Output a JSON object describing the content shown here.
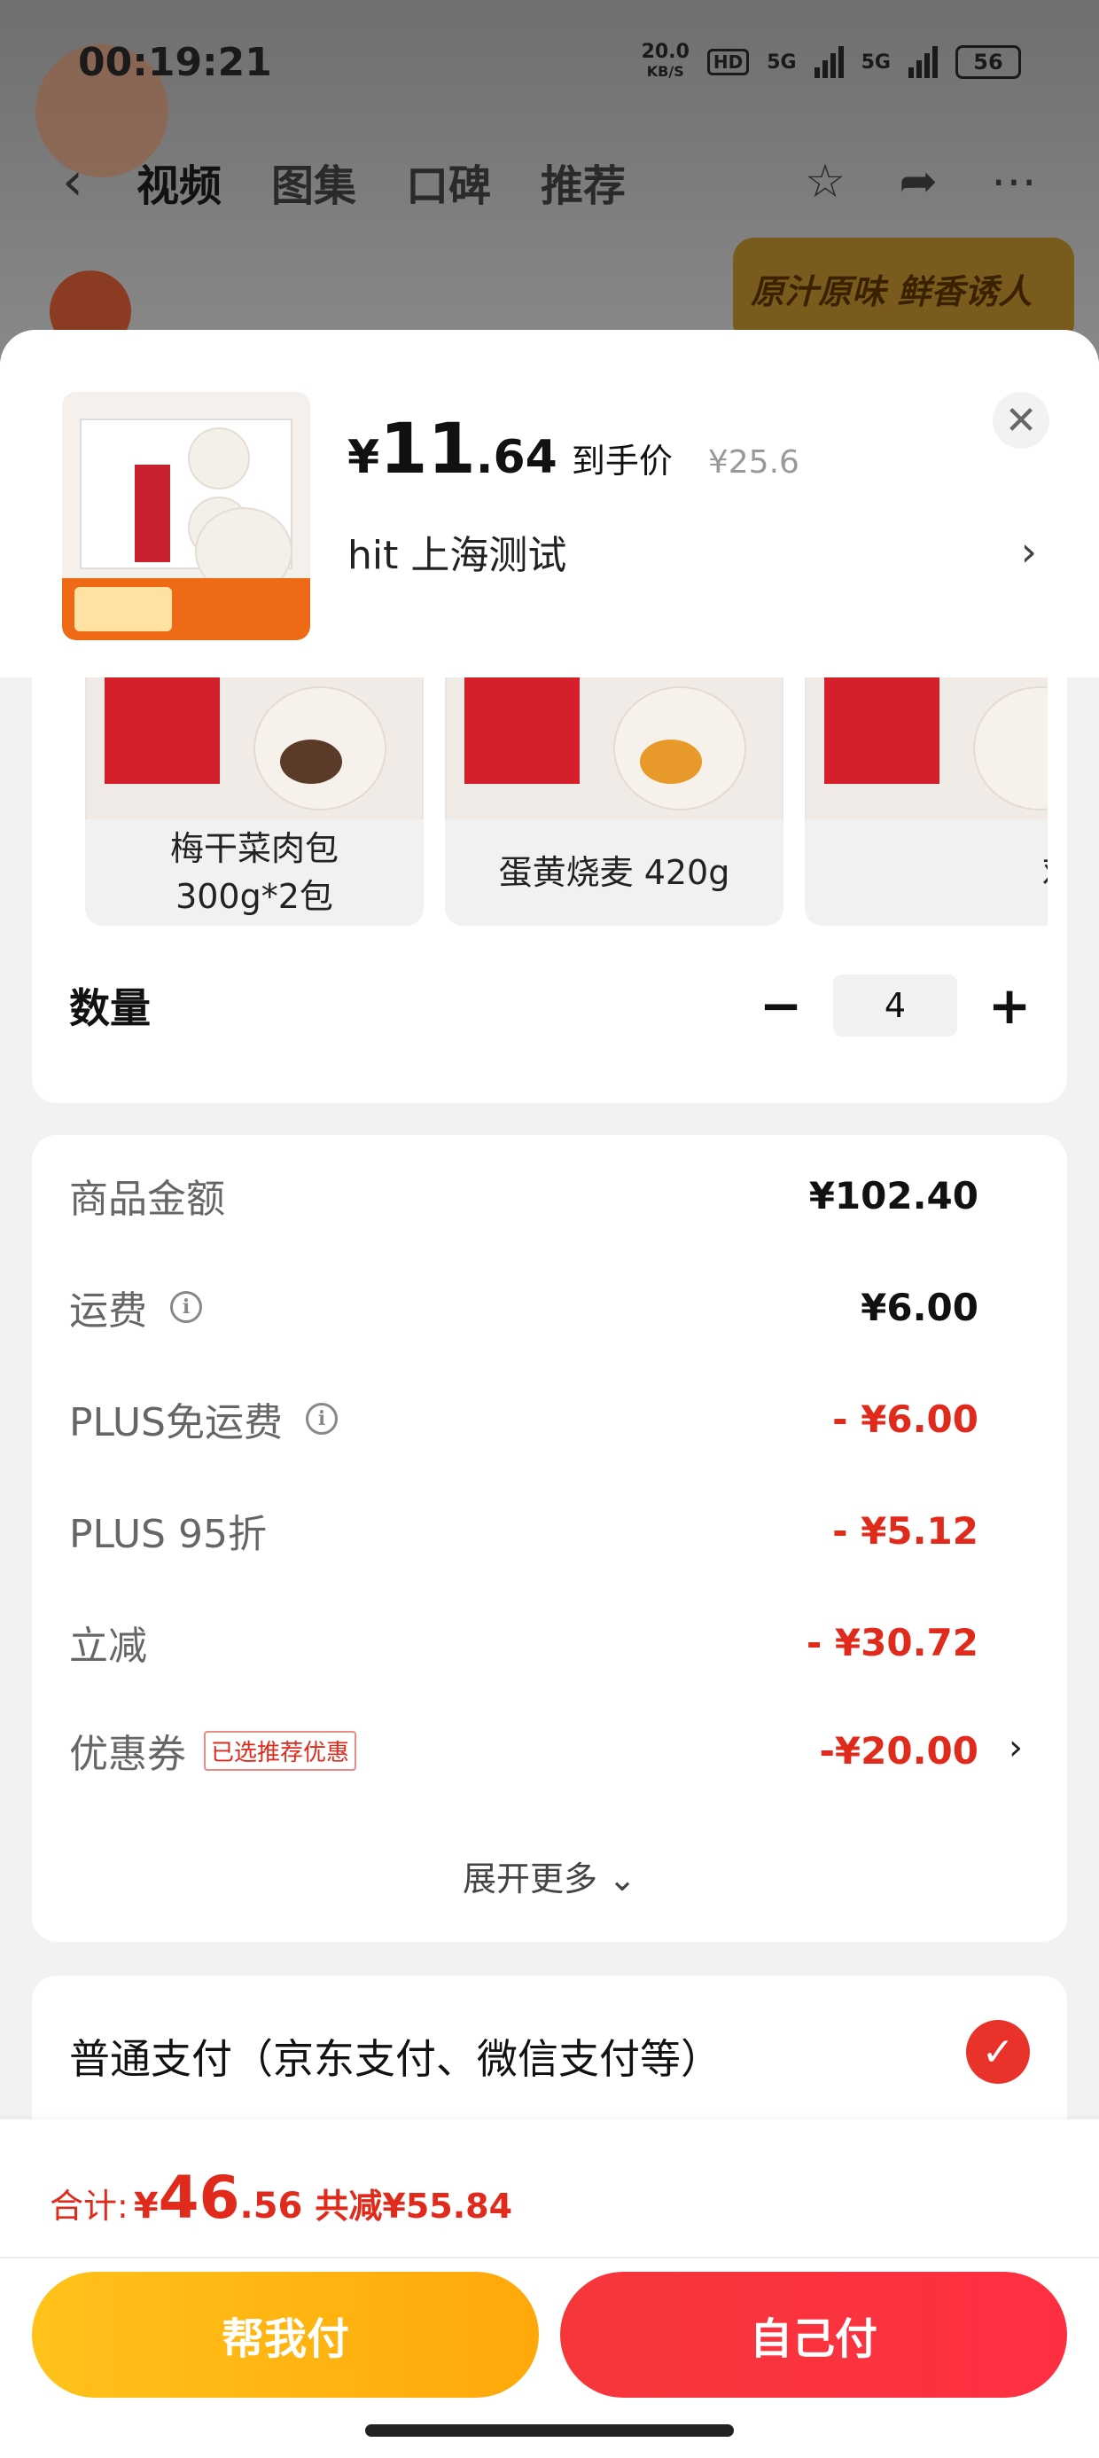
{
  "status_bar": {
    "time": "00:19:21",
    "net_speed": "20.0",
    "net_unit": "KB/S",
    "hd": "HD",
    "signal1": "5G",
    "signal2": "5G",
    "battery": "56"
  },
  "bg_nav": {
    "tabs": [
      "视频",
      "图集",
      "口碑",
      "推荐"
    ],
    "banner": "原汁原味 鲜香诱人"
  },
  "header": {
    "price_currency": "¥",
    "price_int": "11",
    "price_dec": ".64",
    "price_note": "到手价",
    "original_price": "¥25.6",
    "address": "hit  上海测试"
  },
  "variants": [
    {
      "name": "梅干菜肉包\n300g*2包"
    },
    {
      "name": "蛋黄烧麦 420g"
    },
    {
      "name": "鸡肉包"
    }
  ],
  "quantity": {
    "label": "数量",
    "value": "4"
  },
  "breakdown": {
    "goods_label": "商品金额",
    "goods_value": "¥102.40",
    "shipping_label": "运费",
    "shipping_value": "¥6.00",
    "plus_free_label": "PLUS免运费",
    "plus_free_value": "- ¥6.00",
    "plus_discount_label": "PLUS 95折",
    "plus_discount_value": "- ¥5.12",
    "instant_label": "立减",
    "instant_value": "- ¥30.72",
    "coupon_label": "优惠券",
    "coupon_tag": "已选推荐优惠",
    "coupon_value": "-¥20.00",
    "expand_label": "展开更多"
  },
  "payment": {
    "method": "普通支付（京东支付、微信支付等）"
  },
  "footer": {
    "total_label": "合计:",
    "total_currency": "¥",
    "total_int": "46",
    "total_dec": ".56",
    "saved": "共减¥55.84",
    "help_pay": "帮我付",
    "self_pay": "自己付"
  },
  "colors": {
    "red": "#e02b1c",
    "yellow": "#ffb812",
    "button_red": "#f5373b"
  }
}
